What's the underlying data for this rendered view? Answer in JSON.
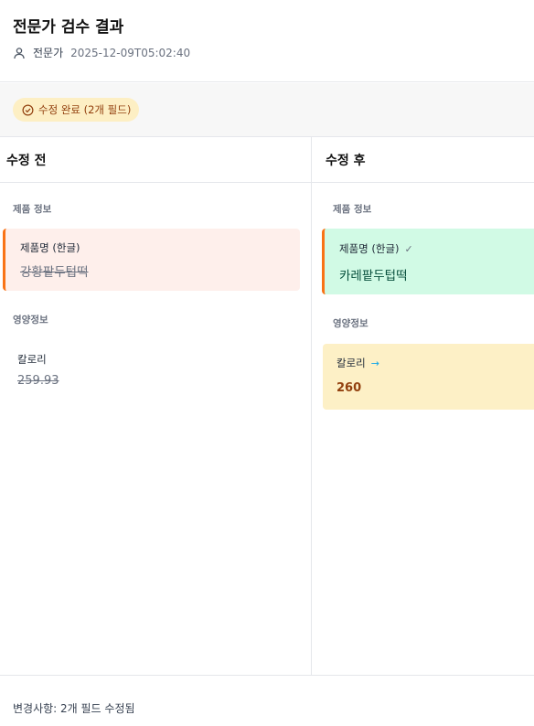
{
  "header": {
    "title": "전문가 검수 결과",
    "reviewer": "전문가",
    "timestamp": "2025-12-09T05:02:40"
  },
  "status": {
    "badge": "수정 완료 (2개 필드)"
  },
  "before": {
    "heading": "수정 전",
    "sections": [
      {
        "label": "제품 정보",
        "field": "제품명 (한글)",
        "value": "강황팥두텁떡"
      },
      {
        "label": "영양정보",
        "field": "칼로리",
        "value": "259.93"
      }
    ]
  },
  "after": {
    "heading": "수정 후",
    "sections": [
      {
        "label": "제품 정보",
        "field": "제품명 (한글)",
        "value": "카레팥두텁떡"
      },
      {
        "label": "영양정보",
        "field": "칼로리",
        "value": "260"
      }
    ]
  },
  "footer": {
    "summary": "변경사항: 2개 필드 수정됨"
  },
  "colors": {
    "removed_bg": "#feefeb",
    "added_bg": "#d1fae5",
    "modified_bg": "#fdf0c6",
    "accent_bar": "#f97316",
    "badge_bg": "#fdefc4",
    "badge_text": "#92400e"
  },
  "icons": [
    "user-icon",
    "check-circle-icon",
    "check-icon",
    "arrow-right-icon"
  ]
}
